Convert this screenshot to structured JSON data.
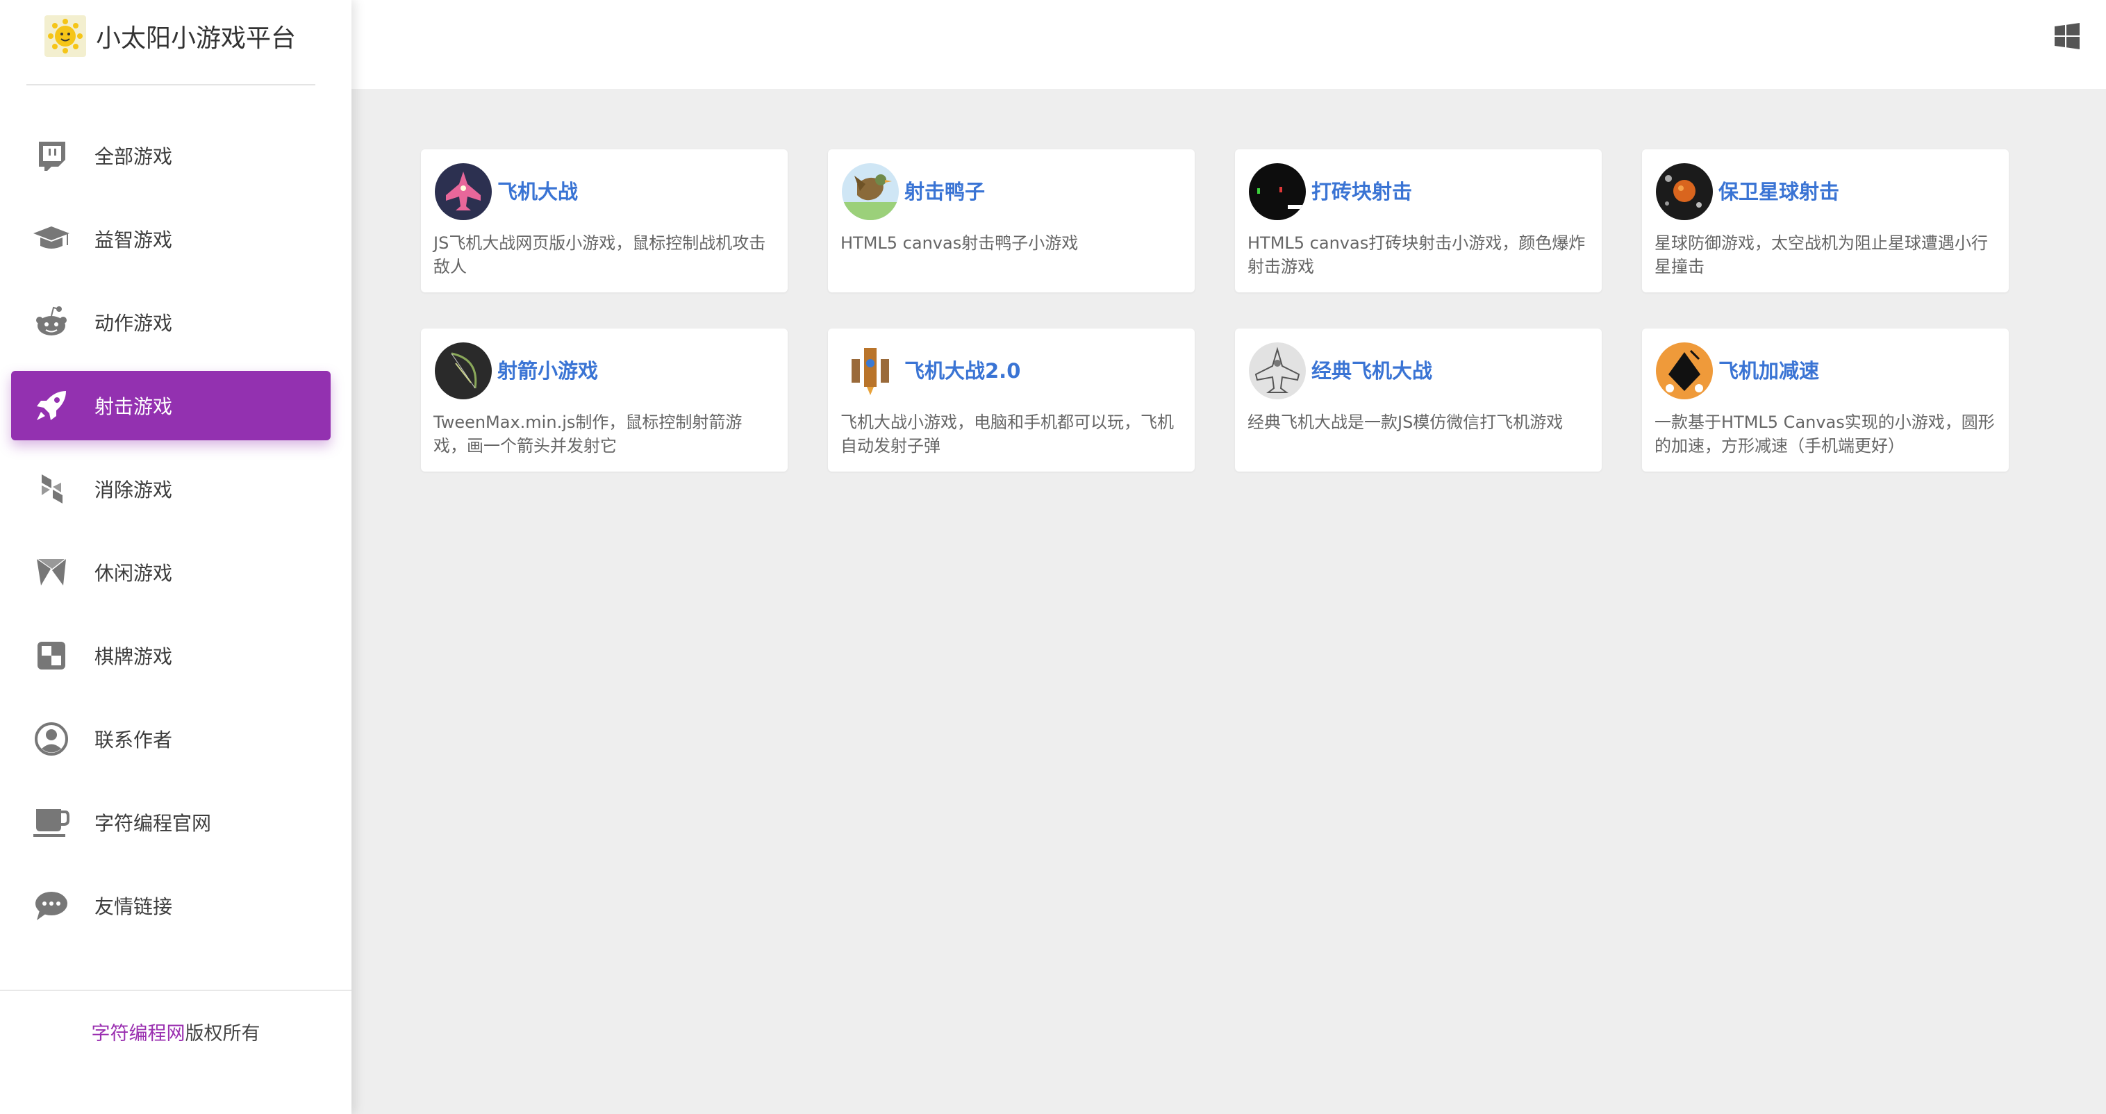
{
  "app": {
    "title": "小太阳小游戏平台"
  },
  "sidebar": {
    "items": [
      {
        "label": "全部游戏",
        "icon": "chat-box-icon"
      },
      {
        "label": "益智游戏",
        "icon": "graduation-cap-icon"
      },
      {
        "label": "动作游戏",
        "icon": "reddit-alien-icon"
      },
      {
        "label": "射击游戏",
        "icon": "rocket-icon",
        "active": true
      },
      {
        "label": "消除游戏",
        "icon": "blocks-icon"
      },
      {
        "label": "休闲游戏",
        "icon": "pinwheel-icon"
      },
      {
        "label": "棋牌游戏",
        "icon": "checker-icon"
      },
      {
        "label": "联系作者",
        "icon": "user-circle-icon"
      },
      {
        "label": "字符编程官网",
        "icon": "coffee-cup-icon"
      },
      {
        "label": "友情链接",
        "icon": "speech-bubble-icon"
      }
    ]
  },
  "footer": {
    "link": "字符编程网",
    "text": "版权所有"
  },
  "games": [
    {
      "title": "飞机大战",
      "desc": "JS飞机大战网页版小游戏，鼠标控制战机攻击敌人",
      "thumb": "pink-plane-icon"
    },
    {
      "title": "射击鸭子",
      "desc": "HTML5 canvas射击鸭子小游戏",
      "thumb": "duck-icon"
    },
    {
      "title": "打砖块射击",
      "desc": "HTML5 canvas打砖块射击小游戏，颜色爆炸射击游戏",
      "thumb": "bricks-icon"
    },
    {
      "title": "保卫星球射击",
      "desc": "星球防御游戏，太空战机为阻止星球遭遇小行星撞击",
      "thumb": "planet-icon"
    },
    {
      "title": "射箭小游戏",
      "desc": "TweenMax.min.js制作，鼠标控制射箭游戏，画一个箭头并发射它",
      "thumb": "bow-icon"
    },
    {
      "title": "飞机大战2.0",
      "desc": "飞机大战小游戏，电脑和手机都可以玩，飞机自动发射子弹",
      "thumb": "battleship-icon"
    },
    {
      "title": "经典飞机大战",
      "desc": "经典飞机大战是一款JS模仿微信打飞机游戏",
      "thumb": "sketch-plane-icon"
    },
    {
      "title": "飞机加减速",
      "desc": "一款基于HTML5 Canvas实现的小游戏，圆形的加速，方形减速（手机端更好）",
      "thumb": "black-diamond-icon"
    }
  ],
  "colors": {
    "accent": "#9331b0",
    "title_blue": "#3a74d4",
    "background": "#eeeeee"
  }
}
